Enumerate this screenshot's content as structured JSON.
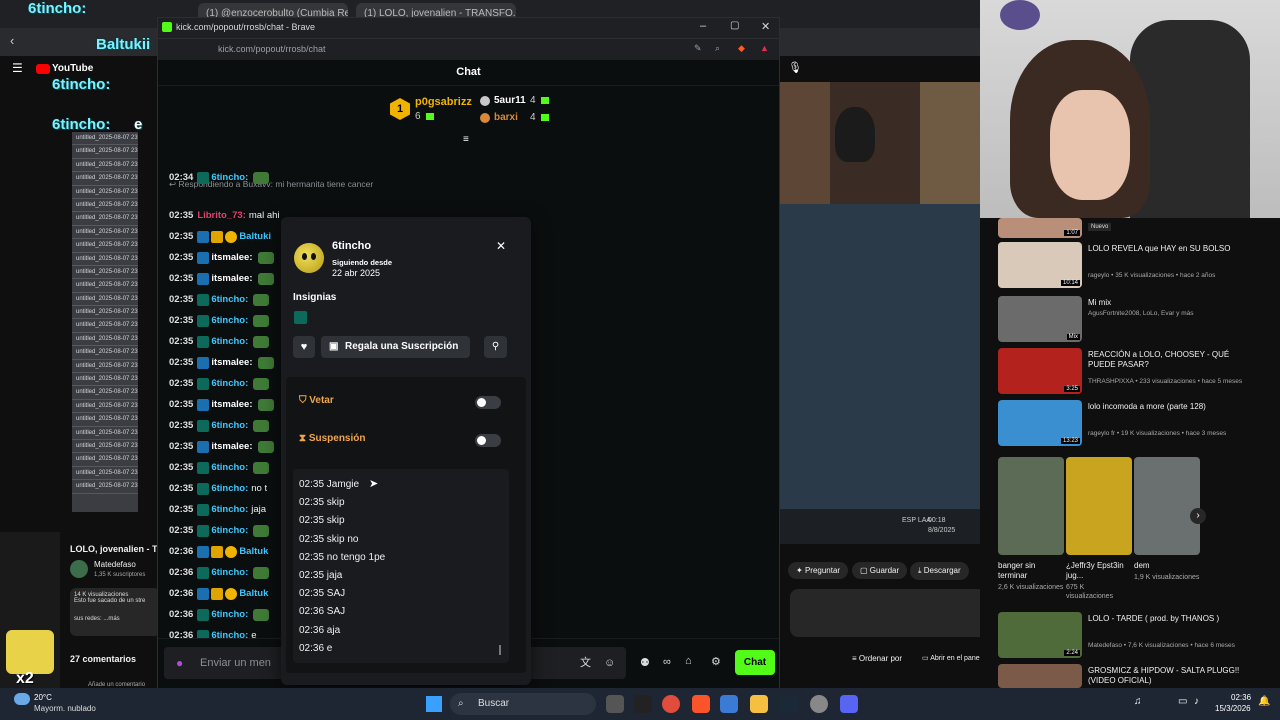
{
  "bg_browser": {
    "tabs": [
      "(1) @enzocerobulto (Cumbia Remi...",
      "(1) LOLO, jovenalien - TRANSFO..."
    ],
    "youtube_logo": "YouTube",
    "files": [
      "untitled_2025-08-07 23...",
      "untitled_2025-08-07 23...",
      "untitled_2025-08-07 23...",
      "untitled_2025-08-07 23...",
      "untitled_2025-08-07 23...",
      "untitled_2025-08-07 23...",
      "untitled_2025-08-07 23...",
      "untitled_2025-08-07 23...",
      "untitled_2025-08-07 23...",
      "untitled_2025-08-07 23...",
      "untitled_2025-08-07 23...",
      "untitled_2025-08-07 23...",
      "untitled_2025-08-07 23...",
      "untitled_2025-08-07 23...",
      "untitled_2025-08-07 23...",
      "untitled_2025-08-07 23...",
      "untitled_2025-08-07 23...",
      "untitled_2025-08-07 23...",
      "untitled_2025-08-07 23...",
      "untitled_2025-08-07 23...",
      "untitled_2025-08-07 23...",
      "untitled_2025-08-07 23...",
      "untitled_2025-08-07 23...",
      "untitled_2025-08-07 23...",
      "untitled_2025-08-07 23...",
      "untitled_2025-08-07 23...",
      "untitled_2025-08-07 23..."
    ],
    "video_title": "LOLO, jovenalien - T",
    "channel": "Matedefaso",
    "subs": "1,35 K suscriptores",
    "desc_line1": "14 K visualizaciones",
    "desc_line2": "Esto fue sacado de un stre",
    "desc_more": "sus redes: ...más",
    "comments": "27 comentarios",
    "add_comment": "Añade un comentario",
    "actions": {
      "ask": "Preguntar",
      "save": "Guardar",
      "download": "Descargar"
    },
    "recs": [
      {
        "title": "LOLO REVELA que HAY en SU BOLSO",
        "meta": "rageylo • 35 K visualizaciones • hace 2 años",
        "dur": "10:14",
        "color": "#d8c9b8"
      },
      {
        "title": "Mi mix",
        "meta": "AgusFortnite2008, LoLo, Evar y más",
        "dur": "Mix",
        "color": "#6b6b6b"
      },
      {
        "title": "REACCIÓN a LOLO, CHOOSEY - QUÉ PUEDE PASAR?",
        "meta": "THRASHPIXXA • 233 visualizaciones • hace 5 meses",
        "dur": "3:25",
        "color": "#b3221c"
      },
      {
        "title": "lolo incomoda a more (parte 128)",
        "meta": "rageylo fr • 19 K visualizaciones • hace 3 meses",
        "dur": "13:23",
        "color": "#3a8fd0"
      }
    ],
    "rec_top_dur": "1:07",
    "rec_top_badge": "Nuevo",
    "shelf": [
      {
        "title": "banger sin terminar",
        "meta": "2,6 K visualizaciones",
        "color": "#5b6b55"
      },
      {
        "title": "¿Jeffr3y Epst3in jug...",
        "meta": "675 K visualizaciones",
        "color": "#c9a41f"
      },
      {
        "title": "dem",
        "meta": "1,9 K visualizaciones",
        "color": "#6a6f70"
      }
    ],
    "rec_bottom": [
      {
        "title": "LOLO - TARDE ( prod. by THANOS )",
        "meta": "Matedefaso • 7,6 K visualizaciones • hace 6 meses",
        "dur": "2:24",
        "color": "#4f6b3a"
      },
      {
        "title": "GROSMICZ & HIPDOW - SALTA PLUGG!! (VIDEO OFICIAL)",
        "meta": "",
        "dur": "",
        "color": "#7b5a4a"
      }
    ],
    "player_controls": {
      "lang": "ESP LAA",
      "time": "00:18",
      "date": "8/8/2025"
    },
    "bottom_bar": {
      "sort": "Ordenar por",
      "panel": "Abrir en el panel"
    }
  },
  "overlay": {
    "name1": "6tincho:",
    "name2": "Baltukii",
    "name3": "6tincho:",
    "name4": "6tincho:",
    "name5": "e"
  },
  "kick": {
    "window_title": "kick.com/popout/rrosb/chat - Brave",
    "url": "kick.com/popout/rrosb/chat",
    "chat_title": "Chat",
    "pinned": {
      "first": {
        "rank": "1",
        "name": "p0gsabrizz",
        "count": "6"
      },
      "second": {
        "name": "5aur11",
        "count": "4"
      },
      "third": {
        "name": "barxi",
        "count": "4"
      }
    },
    "replying_to": "Respondiendo a Buxavv: mi hermanita tiene cancer",
    "messages": [
      {
        "time": "02:34",
        "badges": [
          "sub"
        ],
        "user": "6tincho:",
        "text": "",
        "color": "#3cc8ff",
        "avatar": true
      },
      {
        "time": "02:35",
        "badges": [],
        "user": "Librito_73:",
        "text": "mal ahi",
        "color": "#e0416a",
        "avatar": false
      },
      {
        "time": "02:35",
        "badges": [
          "x",
          "crown",
          "gold"
        ],
        "user": "Baltuki",
        "text": "",
        "color": "#3cc8ff",
        "avatar": false
      },
      {
        "time": "02:35",
        "badges": [
          "x"
        ],
        "user": "itsmalee:",
        "text": "",
        "color": "#ffffff",
        "avatar": true
      },
      {
        "time": "02:35",
        "badges": [
          "x"
        ],
        "user": "itsmalee:",
        "text": "",
        "color": "#ffffff",
        "avatar": true
      },
      {
        "time": "02:35",
        "badges": [
          "sub"
        ],
        "user": "6tincho:",
        "text": "",
        "color": "#3cc8ff",
        "avatar": true
      },
      {
        "time": "02:35",
        "badges": [
          "sub"
        ],
        "user": "6tincho:",
        "text": "",
        "color": "#3cc8ff",
        "avatar": true
      },
      {
        "time": "02:35",
        "badges": [
          "sub"
        ],
        "user": "6tincho:",
        "text": "",
        "color": "#3cc8ff",
        "avatar": true
      },
      {
        "time": "02:35",
        "badges": [
          "x"
        ],
        "user": "itsmalee:",
        "text": "",
        "color": "#ffffff",
        "avatar": true
      },
      {
        "time": "02:35",
        "badges": [
          "sub"
        ],
        "user": "6tincho:",
        "text": "",
        "color": "#3cc8ff",
        "avatar": true
      },
      {
        "time": "02:35",
        "badges": [
          "x"
        ],
        "user": "itsmalee:",
        "text": "",
        "color": "#ffffff",
        "avatar": true
      },
      {
        "time": "02:35",
        "badges": [
          "sub"
        ],
        "user": "6tincho:",
        "text": "",
        "color": "#3cc8ff",
        "avatar": true
      },
      {
        "time": "02:35",
        "badges": [
          "x"
        ],
        "user": "itsmalee:",
        "text": "",
        "color": "#ffffff",
        "avatar": true
      },
      {
        "time": "02:35",
        "badges": [
          "sub"
        ],
        "user": "6tincho:",
        "text": "",
        "color": "#3cc8ff",
        "avatar": true
      },
      {
        "time": "02:35",
        "badges": [
          "sub"
        ],
        "user": "6tincho:",
        "text": "no t",
        "color": "#3cc8ff",
        "avatar": false
      },
      {
        "time": "02:35",
        "badges": [
          "sub"
        ],
        "user": "6tincho:",
        "text": "jaja",
        "color": "#3cc8ff",
        "avatar": false
      },
      {
        "time": "02:35",
        "badges": [
          "sub"
        ],
        "user": "6tincho:",
        "text": "",
        "color": "#3cc8ff",
        "avatar": true
      },
      {
        "time": "02:36",
        "badges": [
          "x",
          "crown",
          "gold"
        ],
        "user": "Baltuk",
        "text": "",
        "color": "#3cc8ff",
        "avatar": false
      },
      {
        "time": "02:36",
        "badges": [
          "sub"
        ],
        "user": "6tincho:",
        "text": "",
        "color": "#3cc8ff",
        "avatar": true
      },
      {
        "time": "02:36",
        "badges": [
          "x",
          "crown",
          "gold"
        ],
        "user": "Baltuk",
        "text": "",
        "color": "#3cc8ff",
        "avatar": false
      },
      {
        "time": "02:36",
        "badges": [
          "sub"
        ],
        "user": "6tincho:",
        "text": "",
        "color": "#3cc8ff",
        "avatar": true
      },
      {
        "time": "02:36",
        "badges": [
          "sub"
        ],
        "user": "6tincho:",
        "text": "e",
        "color": "#3cc8ff",
        "avatar": false
      }
    ],
    "input_placeholder": "Enviar un men",
    "chat_button": "Chat",
    "user_card": {
      "username": "6tincho",
      "following_label": "Siguiendo desde",
      "following_date": "22 abr 2025",
      "badges_title": "Insignias",
      "gift_button": "Regala una Suscripción",
      "ban_label": "Vetar",
      "timeout_label": "Suspensión",
      "history": [
        "02:35 Jamgie",
        "02:35 skip",
        "02:35 skip",
        "02:35 skip no",
        "02:35 no tengo 1pe",
        "02:35 jaja",
        "02:35 SAJ",
        "02:36 SAJ",
        "02:36 aja",
        "02:36 e"
      ]
    }
  },
  "taskbar": {
    "weather_temp": "20°C",
    "weather_desc": "Mayorm. nublado",
    "search": "Buscar",
    "time": "02:36",
    "date": "15/3/2026",
    "x2": "x2"
  }
}
